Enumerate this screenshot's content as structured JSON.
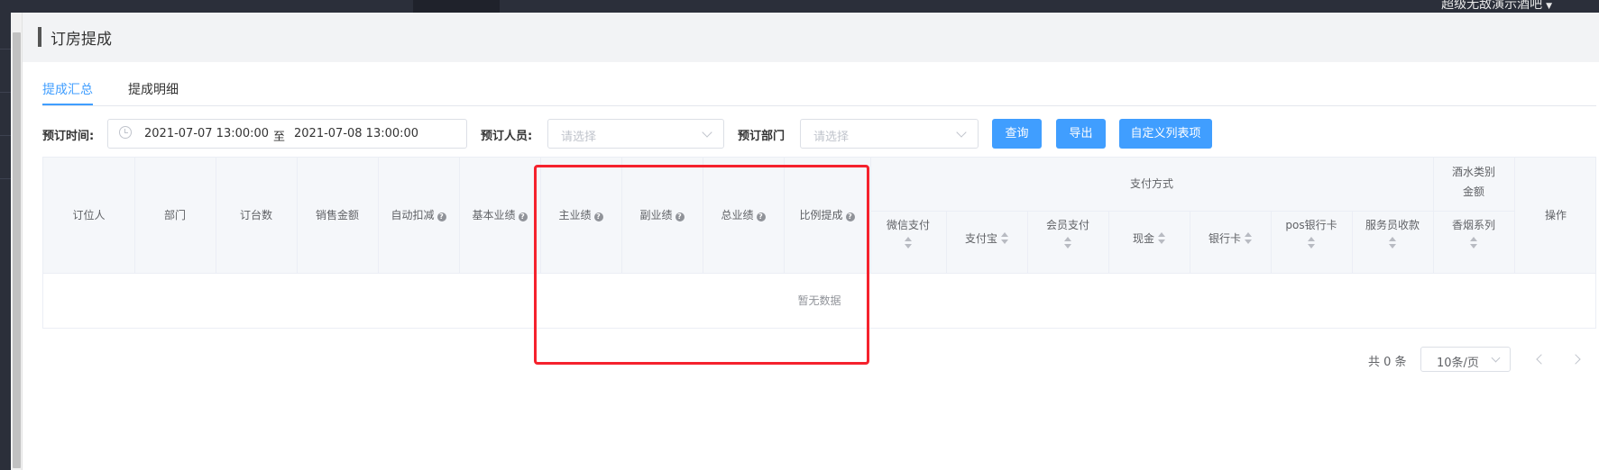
{
  "topbar": {
    "venue_name": "超级无敌演示酒吧"
  },
  "page": {
    "title": "订房提成"
  },
  "tabs": [
    {
      "label": "提成汇总",
      "active": true
    },
    {
      "label": "提成明细",
      "active": false
    }
  ],
  "filters": {
    "time_label": "预订时间:",
    "date_start": "2021-07-07 13:00:00",
    "date_separator": "至",
    "date_end": "2021-07-08 13:00:00",
    "person_label": "预订人员:",
    "person_placeholder": "请选择",
    "dept_label": "预订部门",
    "dept_placeholder": "请选择"
  },
  "buttons": {
    "query": "查询",
    "export": "导出",
    "custom_columns": "自定义列表项"
  },
  "table": {
    "columns": {
      "booker": "订位人",
      "department": "部门",
      "table_count": "订台数",
      "sales_amount": "销售金额",
      "auto_deduct": "自动扣减",
      "base_perf": "基本业绩",
      "main_perf": "主业绩",
      "sub_perf": "副业绩",
      "total_perf": "总业绩",
      "ratio_commission": "比例提成",
      "payment_group": "支付方式",
      "wechat": "微信支付",
      "alipay": "支付宝",
      "member_pay": "会员支付",
      "cash": "现金",
      "bank_card": "银行卡",
      "pos_bank_card": "pos银行卡",
      "waiter_collect": "服务员收款",
      "liquor_group": "酒水类别金额",
      "tobacco": "香烟系列",
      "actions": "操作"
    },
    "empty_text": "暂无数据"
  },
  "pagination": {
    "total": "共 0 条",
    "page_size": "10条/页"
  },
  "colors": {
    "primary": "#409eff",
    "highlight": "#f5222d"
  }
}
